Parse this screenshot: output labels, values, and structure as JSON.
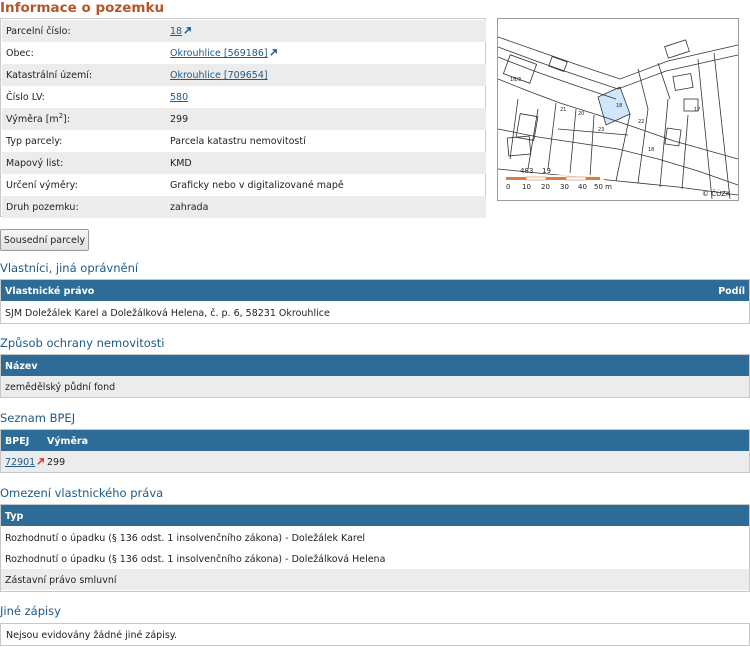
{
  "page": {
    "title": "Informace o pozemku"
  },
  "info_rows": [
    {
      "label": "Parcelní číslo:",
      "value": "18",
      "link": true
    },
    {
      "label": "Obec:",
      "value": "Okrouhlice [569186]",
      "link": true
    },
    {
      "label": "Katastrální území:",
      "value": "Okrouhlice [709654]",
      "link": true
    },
    {
      "label": "Číslo LV:",
      "value": "580",
      "link": true
    },
    {
      "label_main": "Výměra [m",
      "label_sup": "2",
      "label_tail": "]:",
      "value": "299"
    },
    {
      "label": "Typ parcely:",
      "value": "Parcela katastru nemovitostí"
    },
    {
      "label": "Mapový list:",
      "value": "KMD"
    },
    {
      "label": "Určení výměry:",
      "value": "Graficky nebo v digitalizované mapě"
    },
    {
      "label": "Druh pozemku:",
      "value": "zahrada"
    }
  ],
  "map": {
    "scale_labels": [
      "0",
      "10",
      "20",
      "30",
      "40",
      "50 m"
    ],
    "copyright": "© ČÚZK",
    "parcel_labels": [
      "483",
      "19",
      "18",
      "20",
      "23",
      "21",
      "22",
      "18",
      "16/3",
      "17"
    ],
    "highlight_color": "#cfe6fb",
    "scale_color": "#e07b39"
  },
  "neighbors_button": "Sousední parcely",
  "owners": {
    "heading": "Vlastníci, jiná oprávnění",
    "col_right_title": "Vlastnické právo",
    "col_share": "Podíl",
    "rows": [
      "SJM Doležálek Karel a Doležálková Helena, č. p. 6, 58231 Okrouhlice"
    ]
  },
  "protection": {
    "heading": "Způsob ochrany nemovitosti",
    "col_name": "Název",
    "rows": [
      "zemědělský půdní fond"
    ]
  },
  "bpej": {
    "heading": "Seznam BPEJ",
    "col_bpej": "BPEJ",
    "col_area": "Výměra",
    "rows": [
      {
        "code": "72901",
        "area": "299"
      }
    ]
  },
  "restrictions": {
    "heading": "Omezení vlastnického práva",
    "col_type": "Typ",
    "rows": [
      "Rozhodnutí o úpadku (§ 136 odst. 1 insolvenčního zákona) - Doležálek Karel",
      "Rozhodnutí o úpadku (§ 136 odst. 1 insolvenčního zákona) - Doležálková Helena",
      "Zástavní právo smluvní"
    ]
  },
  "other": {
    "heading": "Jiné zápisy",
    "text": "Nejsou evidovány žádné jiné zápisy."
  },
  "colors": {
    "title": "#b4552a",
    "heading": "#1f5a86",
    "table_header": "#2c6c96",
    "row_alt": "#ececec",
    "link": "#1f5a86",
    "ext_link_icon": "#1f5a86",
    "ext_link_icon_alt": "#d9362b"
  }
}
